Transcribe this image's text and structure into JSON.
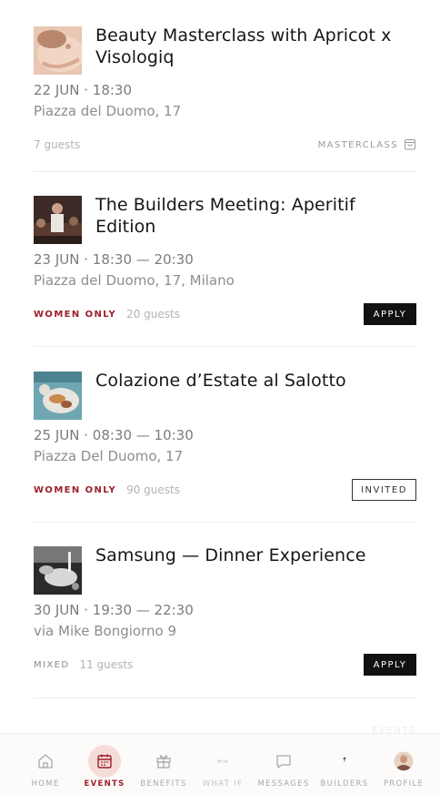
{
  "events": [
    {
      "title": "Beauty Masterclass with Apricot x Visologiq",
      "datetime": "22 JUN · 18:30",
      "location": "Piazza del Duomo, 17",
      "tag": "",
      "guests": "7 guests",
      "category": "MASTERCLASS",
      "action": ""
    },
    {
      "title": "The Builders Meeting: Aperitif Edition",
      "datetime": "23 JUN · 18:30 — 20:30",
      "location": "Piazza del Duomo, 17, Milano",
      "tag": "WOMEN ONLY",
      "guests": "20 guests",
      "action": "APPLY"
    },
    {
      "title": "Colazione d’Estate al Salotto",
      "datetime": "25 JUN · 08:30 — 10:30",
      "location": "Piazza Del Duomo, 17",
      "tag": "WOMEN ONLY",
      "guests": "90 guests",
      "action": "INVITED"
    },
    {
      "title": "Samsung — Dinner Experience",
      "datetime": "30 JUN · 19:30 — 22:30",
      "location": "via Mike Bongiorno 9",
      "tag": "MIXED",
      "guests": "11 guests",
      "action": "APPLY"
    }
  ],
  "faded_label": "EVENTS",
  "tabs": [
    {
      "label": "HOME",
      "icon": "home-icon"
    },
    {
      "label": "EVENTS",
      "icon": "calendar-icon"
    },
    {
      "label": "BENEFITS",
      "icon": "gift-icon"
    },
    {
      "label": "WHAT IF",
      "icon": "sparkle-icon"
    },
    {
      "label": "MESSAGES",
      "icon": "message-icon"
    },
    {
      "label": "BUILDERS",
      "icon": "builders-icon"
    },
    {
      "label": "PROFILE",
      "icon": "avatar-icon"
    }
  ],
  "colors": {
    "accent": "#9c1f2a",
    "active_tab_bg": "#f6dcd8",
    "button_dark": "#111111"
  }
}
